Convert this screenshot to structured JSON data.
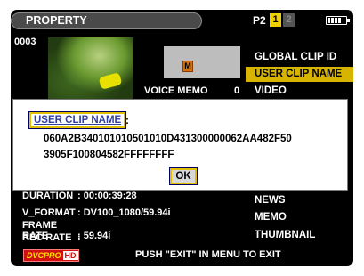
{
  "header": {
    "title": "PROPERTY",
    "card_label": "P2",
    "slot_active": "1",
    "slot_inactive": "2"
  },
  "clip": {
    "number": "0003",
    "memo_icon": "M",
    "voice_memo_label": "VOICE MEMO",
    "voice_memo_count": "0"
  },
  "menu": {
    "items": [
      "GLOBAL CLIP ID",
      "USER CLIP NAME",
      "VIDEO",
      "NEWS",
      "MEMO",
      "THUMBNAIL"
    ],
    "selected_index": 1
  },
  "info": {
    "duration_label": "DURATION",
    "duration_value": ": 00:00:39:28",
    "vformat_label": "V_FORMAT",
    "vformat_value": ": DV100_1080/59.94i",
    "framerate_label": "FRAME RATE",
    "framerate_value": ": 59.94i",
    "recrate_label": "REC RATE",
    "recrate_value": ":"
  },
  "footer": {
    "logo_text": "DVCPRO",
    "logo_hd": "HD",
    "message": "PUSH \"EXIT\" IN MENU TO EXIT"
  },
  "dialog": {
    "label": "USER CLIP NAME",
    "colon": ":",
    "value_line1": "060A2B340101010501010D431300000062AA482F50",
    "value_line2": "3905F100804582FFFFFFFF",
    "ok_label": "OK"
  },
  "colors": {
    "screen_bg": "#000000",
    "selection": "#d6b400",
    "focus_border": "#e0c000",
    "logo_red": "#d01010"
  },
  "icons": {
    "battery": "battery-icon",
    "memo": "memo-icon"
  }
}
